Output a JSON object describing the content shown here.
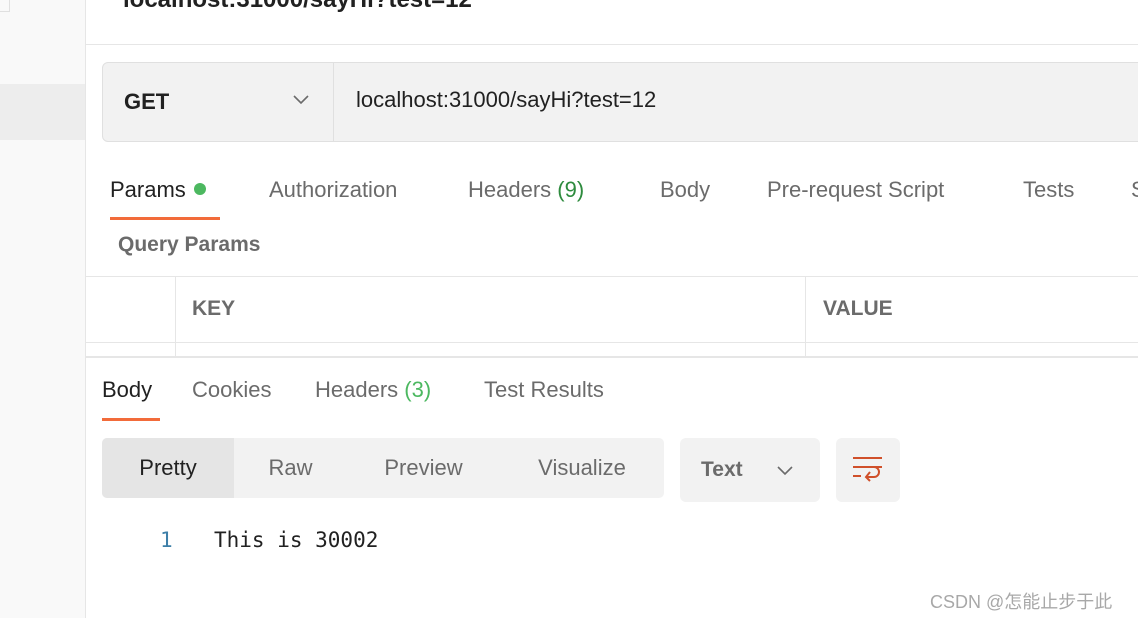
{
  "header": {
    "title": "localhost:31000/sayHi?test=12"
  },
  "request": {
    "method": "GET",
    "url": "localhost:31000/sayHi?test=12",
    "tabs": [
      {
        "label": "Params",
        "active": true,
        "dot": true
      },
      {
        "label": "Authorization"
      },
      {
        "label": "Headers",
        "count": "(9)"
      },
      {
        "label": "Body"
      },
      {
        "label": "Pre-request Script"
      },
      {
        "label": "Tests"
      },
      {
        "label": "S"
      }
    ],
    "query_params_label": "Query Params",
    "table_headers": [
      "KEY",
      "VALUE"
    ]
  },
  "response": {
    "tabs": [
      {
        "label": "Body",
        "active": true
      },
      {
        "label": "Cookies"
      },
      {
        "label": "Headers",
        "count": "(3)"
      },
      {
        "label": "Test Results"
      }
    ],
    "view_modes": [
      "Pretty",
      "Raw",
      "Preview",
      "Visualize"
    ],
    "selected_view": "Pretty",
    "format": "Text",
    "lines": [
      {
        "number": "1",
        "text": "This is 30002"
      }
    ]
  },
  "colors": {
    "accent": "#f26b3a",
    "status_green": "#4cb860",
    "wrap_icon": "#d0502a"
  },
  "watermark": "CSDN @怎能止步于此"
}
